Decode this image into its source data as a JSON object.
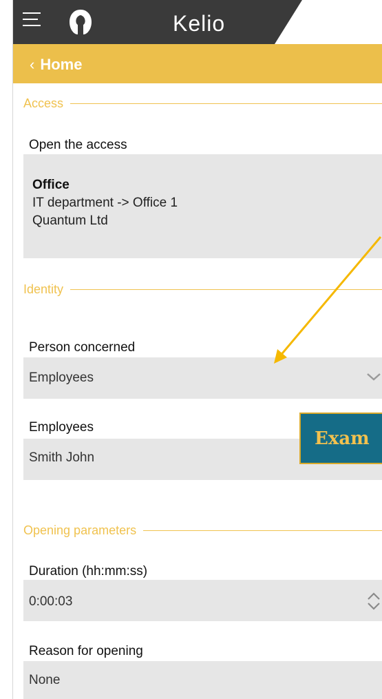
{
  "app": {
    "brand": "Kelio"
  },
  "breadcrumb": {
    "back_label": "Home"
  },
  "access": {
    "section_title": "Access",
    "label": "Open the access",
    "location_title": "Office",
    "location_path": "IT department -> Office 1",
    "company": "Quantum Ltd"
  },
  "identity": {
    "section_title": "Identity",
    "person_label": "Person concerned",
    "person_value": "Employees",
    "employees_label": "Employees",
    "employees_value": "Smith John"
  },
  "opening": {
    "section_title": "Opening parameters",
    "duration_label": "Duration (hh:mm:ss)",
    "duration_value": "0:00:03",
    "reason_label": "Reason for opening",
    "reason_value": "None"
  },
  "callout": {
    "text": "Exam"
  },
  "icons": {
    "menu": "menu-icon",
    "avatar": "avatar-icon",
    "dropdown": "chevron-down-icon",
    "spinner": "spinner-icon"
  },
  "colors": {
    "topbar": "#3a3a3a",
    "accent": "#ecbf4b",
    "section": "#f0c24f",
    "field_bg": "#e6e6e6",
    "arrow": "#f5b800",
    "callout_bg": "#156c87"
  }
}
